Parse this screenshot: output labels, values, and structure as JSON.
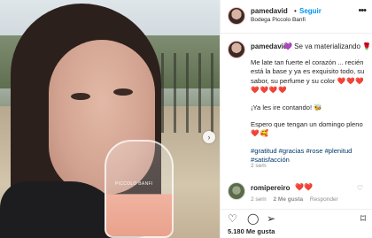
{
  "post": {
    "username": "pamedavid",
    "follow_label": "Seguir",
    "location": "Bodega Piccolo Banfi",
    "glass_text": "PICCOLO BANFI"
  },
  "caption": {
    "username": "pamedavid",
    "first_line": "💜 Se va materializando 🌹",
    "paragraph1": "Me late tan fuerte el corazón ... recién está la base y ya es exquisito todo, su sabor, su perfume y su color",
    "paragraph1_hearts_a": "❤️❤️❤️",
    "paragraph1_hearts_b": "❤️❤️❤️❤️",
    "paragraph2": "¡Ya les ire contando! 🐝",
    "paragraph3": "Espero que tengan un domingo pleno",
    "paragraph3_emoji": "❤️🥰",
    "hashtags": "#gratitud #gracias #rose #plenitud #satisfacción",
    "time": "2 sem"
  },
  "comment": {
    "username": "romipereiro",
    "text": "❤️❤️",
    "time": "2 sem",
    "likes": "2 Me gusta",
    "reply": "Responder"
  },
  "footer": {
    "likes_count": "5.180",
    "likes_label": "Me gusta"
  },
  "icons": {
    "next": "chevron-right-icon",
    "more": "more-icon",
    "like": "heart-icon",
    "comment": "comment-icon",
    "share": "share-icon",
    "save": "bookmark-icon"
  }
}
